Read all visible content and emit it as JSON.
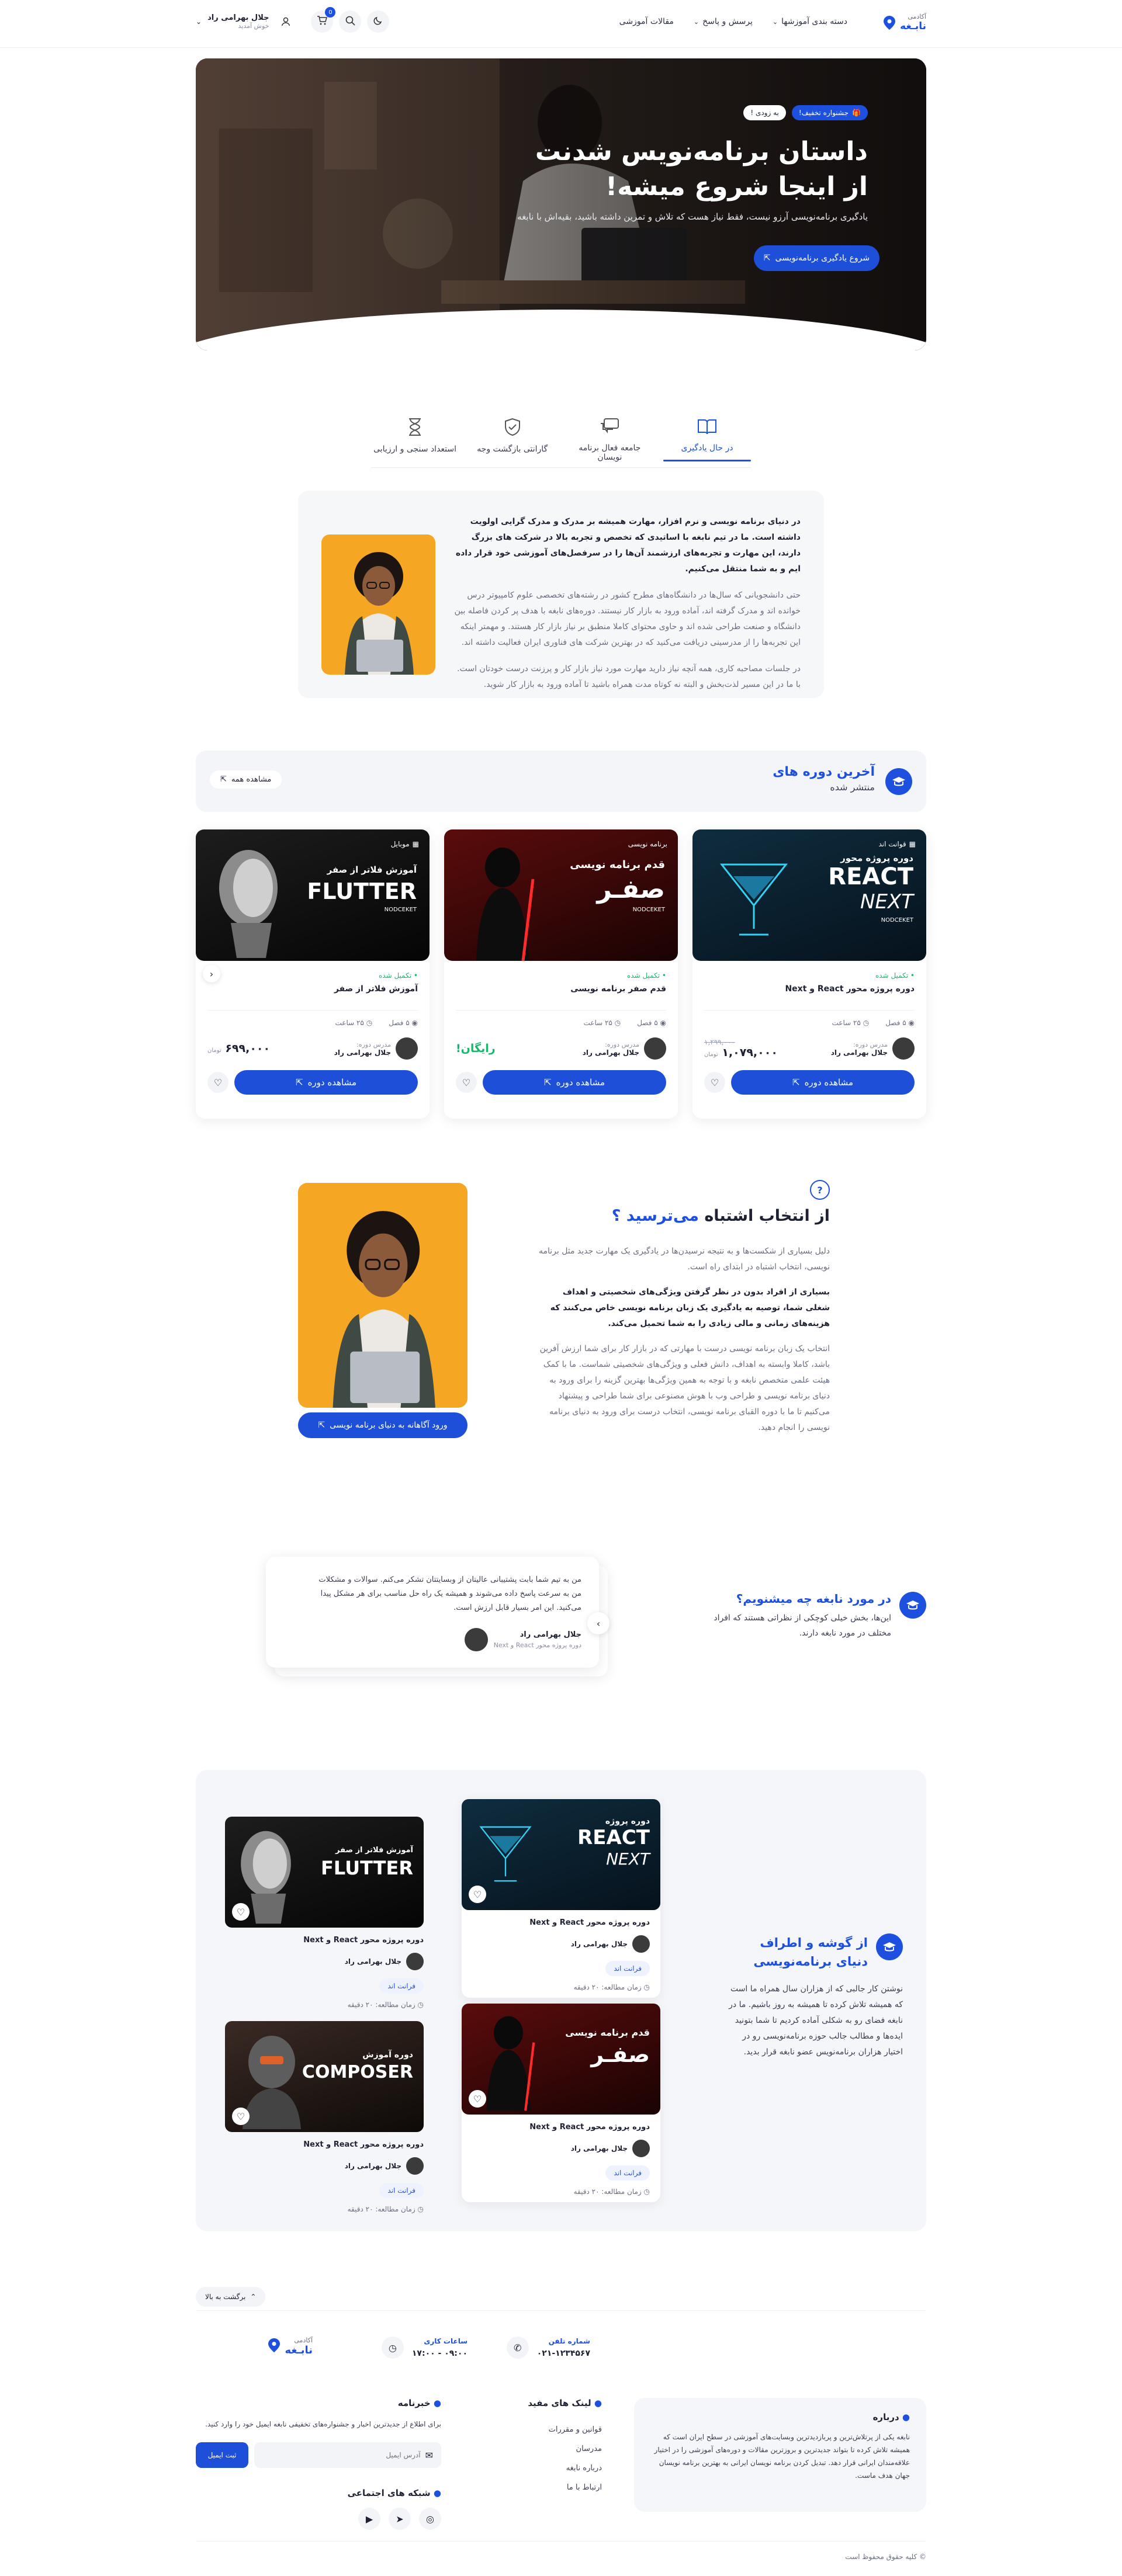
{
  "header": {
    "logo_top": "آکادمی",
    "logo_main": "نابـغه",
    "nav": [
      "دسته بندی آموزشها",
      "پرسش و پاسخ",
      "مقالات آموزشی"
    ],
    "cart_count": "0",
    "user_name": "جلال بهرامی راد",
    "user_greeting": "خوش آمدید"
  },
  "hero": {
    "badge": "جشنواره تخفیف!",
    "badge_sub": "به زودی !",
    "title_line1": "داستان برنامه‌نویس شدنت",
    "title_line2": "از اینجا شروع میشه!",
    "subtitle": "یادگیری برنامه‌نویسی آرزو نیست، فقط نیاز هست که تلاش و تمرین داشته باشید، بقیه‌اش با نابغه",
    "cta": "شروع یادگیری برنامه‌نویسی"
  },
  "features": {
    "tabs": [
      "در حال یادگیری",
      "جامعه فعال برنامه نویسان",
      "گارانتی بازگشت وجه",
      "استعداد سنجی و ارزیابی"
    ],
    "para1": "در دنیای برنامه نویسی و نرم افزار، مهارت همیشه بر مدرک و مدرک گرایی اولویت داشته است. ما در تیم نابغه با اساتیدی که تخصص و تجربه بالا در شرکت های بزرگ دارند، این مهارت و تجربه‌های ارزشمند آن‌ها را در سرفصل‌های آموزشی خود قرار داده ایم و به شما منتقل می‌کنیم.",
    "para2": "حتی دانشجویانی که سال‌ها در دانشگاه‌های مطرح کشور در رشته‌های تخصصی علوم کامپیوتر درس خوانده اند و مدرک گرفته اند، آماده ورود به بازار کار نیستند. دوره‌های نابغه با هدف پر کردن فاصله بین دانشگاه و صنعت طراحی شده اند و حاوی محتوای کاملا منطبق بر نیاز بازار کار هستند. و مهمتر اینکه این تجربه‌ها را از مدرسینی دریافت می‌کنید که در بهترین شرکت های فناوری ایران فعالیت داشته اند.",
    "para3": "در جلسات مصاحبه کاری، همه آنچه نیاز دارید مهارت مورد نیاز بازار کار و پرزنت درست خودتان است. با ما در این مسیر لذت‌بخش و البته نه کوتاه مدت همراه باشید تا آماده ورود به بازار کار شوید."
  },
  "latest": {
    "title": "آخرین دوره های",
    "subtitle": "منتشر شده",
    "see_all": "مشاهده همه",
    "courses": [
      {
        "thumb_l1": "دوره پروژه محور",
        "thumb_l2": "REACT",
        "thumb_l3": "NEXT",
        "brand": "NODCEKET",
        "status": "تکمیل شده",
        "badge": "قوانت اند",
        "name": "دوره پروژه محور React و Next",
        "lessons": "۵ فصل",
        "hours": "۲۵ ساعت",
        "teacher_role": "مدرس دوره:",
        "teacher": "جلال بهرامی راد",
        "old_price": "۱,۲۹۹,۰۰۰",
        "price": "۱,۰۷۹,۰۰۰",
        "currency": "تومان",
        "btn": "مشاهده دوره"
      },
      {
        "thumb_l1": "قدم",
        "thumb_l2": "برنامه نویسی",
        "thumb_l3": "صفـر",
        "brand": "NODCEKET",
        "status": "تکمیل شده",
        "badge": "برنامه نویسی",
        "name": "قدم صفر برنامه نویسی",
        "lessons": "۵ فصل",
        "hours": "۲۵ ساعت",
        "teacher_role": "مدرس دوره:",
        "teacher": "جلال بهرامی راد",
        "price": "رایگان!",
        "btn": "مشاهده دوره"
      },
      {
        "thumb_l1": "آموزش فلاتر از صفر",
        "thumb_l2": "FLUTTER",
        "brand": "NODCEKET",
        "status": "تکمیل شده",
        "badge": "موبایل",
        "name": "آموزش فلاتر از صفر",
        "lessons": "۵ فصل",
        "hours": "۲۵ ساعت",
        "teacher_role": "مدرس دوره:",
        "teacher": "جلال بهرامی راد",
        "price": "۶۹۹,۰۰۰",
        "currency": "تومان",
        "btn": "مشاهده دوره"
      }
    ]
  },
  "fear": {
    "title_a": "از انتخاب اشتباه",
    "title_b": "می‌ترسید ؟",
    "p1": "دلیل بسیاری از شکست‌ها و به نتیجه نرسیدن‌ها در یادگیری یک مهارت جدید مثل برنامه نویسی، انتخاب اشتباه در ابتدای راه است.",
    "p2": "بسیاری از افراد بدون در نظر گرفتن ویژگی‌های شخصیتی و اهداف شغلی شما، توصیه به یادگیری یک زبان برنامه نویسی خاص می‌کنند که هزینه‌های زمانی و مالی زیادی را به شما تحمیل می‌کند.",
    "p3": "انتخاب یک زبان برنامه نویسی درست با مهارتی که در بازار کار برای شما ارزش آفرین باشد، کاملا وابسته به اهداف، دانش فعلی و ویژگی‌های شخصیتی شماست. ما با کمک هیئت علمی متخصص نابغه و با توجه به همین ویژگی‌ها بهترین گزینه را برای ورود به دنیای برنامه نویسی و طراحی وب با هوش مصنوعی برای شما طراحی و پیشنهاد می‌کنیم تا ما با دوره القبای برنامه نویسی، انتخاب درست برای ورود به دنیای برنامه نویسی را انجام دهید.",
    "btn": "ورود آگاهانه به دنیای برنامه نویسی"
  },
  "testimonials": {
    "title": "در مورد نابغه چه میشنویم؟",
    "desc": "این‌ها، بخش خیلی کوچکی از نظراتی هستند که افراد مختلف در مورد نابغه دارند.",
    "quote": "من به تیم شما بابت پشتیبانی عالیتان از وبسایتتان تشکر می‌کنم. سوالات و مشکلات من به سرعت پاسخ داده می‌شوند و همیشه یک راه حل مناسب برای هر مشکل پیدا می‌کنید. این امر بسیار قابل ارزش است.",
    "author": "جلال بهرامی راد",
    "course": "دوره پروژه محور React و Next"
  },
  "blog": {
    "title": "از گوشه و اطراف دنیای برنامه‌نویسی",
    "desc": "نوشتن کار جالبی که از هزاران سال همراه ما است که همیشه تلاش کرده تا همیشه به روز باشیم. ما در نابغه فضای رو به شکلی آماده کردیم تا شما بتونید ایده‌ها و مطالب جالب حوزه برنامه‌نویسی رو در اختیار هزاران برنامه‌نویس عضو نابغه قرار بدید.",
    "posts": [
      {
        "t1": "دوره پروژه",
        "t2": "REACT",
        "t3": "NEXT",
        "title": "دوره پروژه محور React و Next",
        "author": "جلال بهرامی راد",
        "tag": "فرانت اند",
        "time": "زمان مطالعه: ۲۰ دقیقه"
      },
      {
        "t1": "آموزش فلاتر از صفر",
        "t2": "FLUTTER",
        "t3": "",
        "title": "دوره پروژه محور React و Next",
        "author": "جلال بهرامی راد",
        "tag": "فرانت اند",
        "time": "زمان مطالعه: ۲۰ دقیقه"
      },
      {
        "t1": "قدم",
        "t2": "صفـر",
        "t3": "برنامه نویسی",
        "title": "دوره پروژه محور React و Next",
        "author": "جلال بهرامی راد",
        "tag": "فرانت اند",
        "time": "زمان مطالعه: ۲۰ دقیقه"
      },
      {
        "t1": "دوره آموزش",
        "t2": "COMPOSER",
        "t3": "",
        "title": "دوره پروژه محور React و Next",
        "author": "جلال بهرامی راد",
        "tag": "فرانت اند",
        "time": "زمان مطالعه: ۲۰ دقیقه"
      }
    ]
  },
  "footer": {
    "back_top": "برگشت به بالا",
    "phone_label": "شماره تلفن",
    "phone": "۰۲۱-۱۲۳۴۵۶۷",
    "hours_label": "ساعات کاری",
    "hours": "۰۹:۰۰ - ۱۷:۰۰",
    "about_title": "درباره",
    "about_text": "نابغه یکی از پرتلاش‌ترین و پربازدیدترین وبسایت‌های آموزشی در سطح ایران است که همیشه تلاش کرده تا بتواند جدیدترین و بروزترین مقالات و دوره‌های آموزشی را در اختیار علاقه‌مندان ایرانی قرار دهد. تبدیل کردن برنامه نویسان ایرانی به بهترین برنامه نویسان جهان هدف ماست.",
    "links_title": "لینک های مفید",
    "links": [
      "قوانین و مقررات",
      "مدرسان",
      "درباره نابغه",
      "ارتباط با ما"
    ],
    "news_title": "خبرنامه",
    "news_desc": "برای اطلاع از جدیدترین اخبار و جشنواره‌های تخفیفی نابغه ایمیل خود را وارد کنید.",
    "email_placeholder": "آدرس ایمیل",
    "submit": "ثبت ایمیل",
    "social_title": "شبکه های اجتماعی",
    "copyright": "© کلیه حقوق محفوظ است"
  },
  "colors": {
    "primary": "#1e50e0",
    "success": "#18b86b",
    "accent_orange": "#f5a623"
  }
}
